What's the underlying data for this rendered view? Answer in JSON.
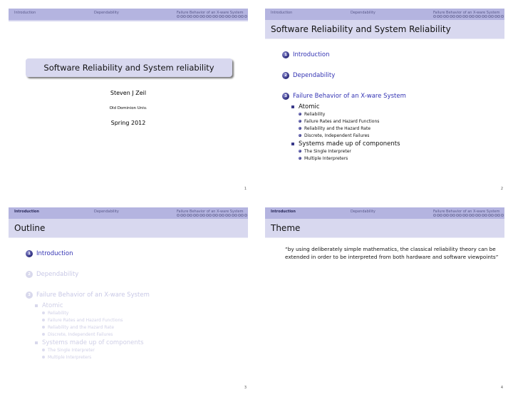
{
  "nav": {
    "sections": [
      "Introduction",
      "Dependability",
      "Failure Behavior of an X-ware System"
    ],
    "dots_count": 22
  },
  "slide1": {
    "title": "Software Reliability and System reliability",
    "author": "Steven J Zeil",
    "institute": "Old Dominion Univ.",
    "date": "Spring 2012",
    "page": "1"
  },
  "slide2": {
    "frametitle": "Software Reliability and System Reliability",
    "page": "2"
  },
  "slide3": {
    "frametitle": "Outline",
    "page": "3"
  },
  "slide4": {
    "frametitle": "Theme",
    "quote": "“by using deliberately simple mathematics, the classical reliability theory can be extended in order to be interpreted from both hardware and software viewpoints”",
    "page": "4"
  },
  "toc": {
    "sections": [
      {
        "num": "1",
        "label": "Introduction"
      },
      {
        "num": "2",
        "label": "Dependability"
      },
      {
        "num": "3",
        "label": "Failure Behavior of an X-ware System"
      }
    ],
    "subsections": [
      {
        "label": "Atomic",
        "items": [
          "Reliability",
          "Failure Rates and Hazard Functions",
          "Reliability and the Hazard Rate",
          "Discrete, Independent Failures"
        ]
      },
      {
        "label": "Systems made up of components",
        "items": [
          "The Single Interpreter",
          "Multiple Interpreters"
        ]
      }
    ]
  },
  "colors": {
    "headline_bg": "#b4b4e0",
    "frametitle_bg": "#d8d8ef",
    "toc_link": "#3333b3"
  }
}
